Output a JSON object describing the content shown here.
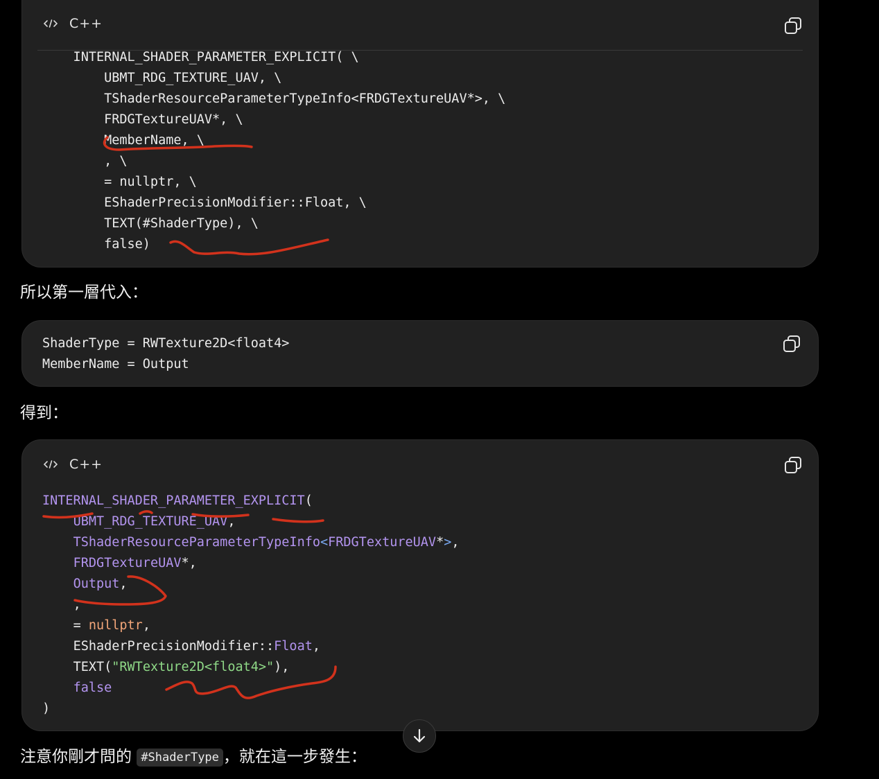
{
  "block1": {
    "language": "C++",
    "lines": [
      "    INTERNAL_SHADER_PARAMETER_EXPLICIT( \\",
      "        UBMT_RDG_TEXTURE_UAV, \\",
      "        TShaderResourceParameterTypeInfo<FRDGTextureUAV*>, \\",
      "        FRDGTextureUAV*, \\",
      "        MemberName, \\",
      "        , \\",
      "        = nullptr, \\",
      "        EShaderPrecisionModifier::Float, \\",
      "        TEXT(#ShaderType), \\",
      "        false)"
    ]
  },
  "text1": "所以第一層代入：",
  "block2": {
    "lines": [
      "ShaderType = RWTexture2D<float4>",
      "MemberName = Output"
    ]
  },
  "text2": "得到：",
  "block3": {
    "language": "C++",
    "l1": "INTERNAL_SHADER_PARAMETER_EXPLICIT",
    "l1b": "(",
    "l2": "UBMT_RDG_TEXTURE_UAV",
    "l3a": "TShaderResourceParameterTypeInfo",
    "l3b": "<",
    "l3c": "FRDGTextureUAV",
    "l3d": "*",
    "l3e": ">",
    "l3f": ",",
    "l4a": "FRDGTextureUAV",
    "l4b": "*,",
    "l5a": "Output",
    "l5b": ",",
    "l6": ",",
    "l7a": "= ",
    "l7b": "nullptr",
    "l7c": ",",
    "l8a": "EShaderPrecisionModifier::",
    "l8b": "Float",
    "l8c": ",",
    "l9a": "TEXT(",
    "l9b": "\"RWTexture2D<float4>\"",
    "l9c": "),",
    "l10": "false",
    "l11": ")"
  },
  "text3_before": "注意你剛才問的 ",
  "text3_code": "#ShaderType",
  "text3_after": "，就在這一步發生：",
  "icons": {
    "code": "code-icon",
    "copy": "copy-icon",
    "scroll": "arrow-down-icon"
  },
  "colors": {
    "background": "#000000",
    "code_block": "#212121",
    "annotation_red": "#d2321c",
    "keyword_purple": "#b394ef",
    "string_green": "#8fd987",
    "literal_orange": "#f2a679"
  }
}
